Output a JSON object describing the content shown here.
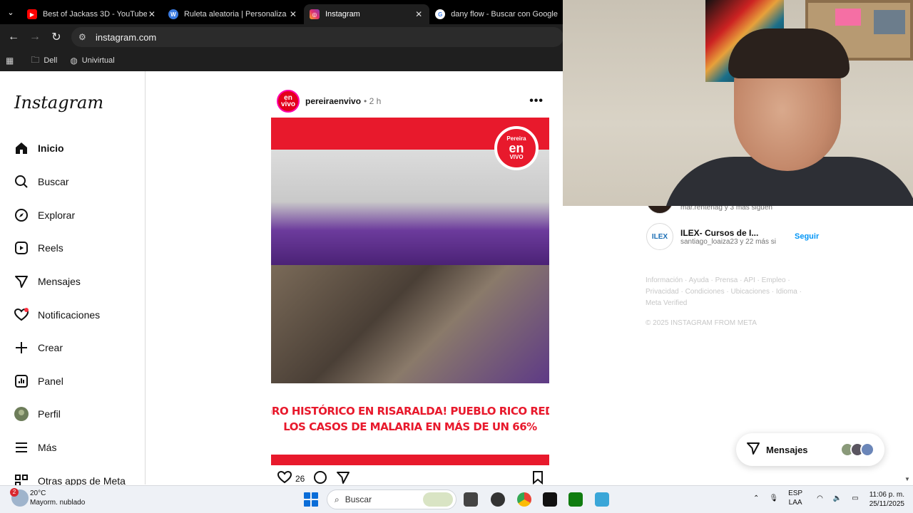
{
  "browser": {
    "tabs": [
      {
        "title": "Best of Jackass 3D - YouTube",
        "favicon": "youtube-icon",
        "active": false
      },
      {
        "title": "Ruleta aleatoria | Personaliza y c",
        "favicon": "wheel-icon",
        "active": false
      },
      {
        "title": "Instagram",
        "favicon": "instagram-icon",
        "active": true
      },
      {
        "title": "dany flow - Buscar con Google",
        "favicon": "google-icon",
        "active": false
      }
    ],
    "url": "instagram.com",
    "bookmarks": [
      {
        "label": "Dell",
        "icon": "folder-icon"
      },
      {
        "label": "Univirtual",
        "icon": "globe-icon"
      }
    ]
  },
  "instagram": {
    "logo": "Instagram",
    "nav": [
      {
        "label": "Inicio",
        "icon": "home-icon"
      },
      {
        "label": "Buscar",
        "icon": "search-icon"
      },
      {
        "label": "Explorar",
        "icon": "compass-icon"
      },
      {
        "label": "Reels",
        "icon": "reels-icon"
      },
      {
        "label": "Mensajes",
        "icon": "send-icon"
      },
      {
        "label": "Notificaciones",
        "icon": "heart-icon"
      },
      {
        "label": "Crear",
        "icon": "plus-icon"
      },
      {
        "label": "Panel",
        "icon": "chart-icon"
      },
      {
        "label": "Perfil",
        "icon": "profile-avatar"
      },
      {
        "label": "Más",
        "icon": "menu-icon"
      },
      {
        "label": "Otras apps de Meta",
        "icon": "apps-icon"
      }
    ],
    "post": {
      "username": "pereiraenvivo",
      "time": "• 2 h",
      "avatar_text": "en vivo",
      "image_logo": {
        "line1": "Pereira",
        "line2": "en",
        "line3": "VIVO"
      },
      "caption_lines": [
        "¡LOGRO HISTÓRICO EN RISARALDA! PUEBLO RICO REDUCE",
        "LOS CASOS DE MALARIA EN MÁS DE UN 66%"
      ],
      "likes": "26"
    },
    "suggestions": [
      {
        "name": "",
        "sub": "mar.renteriag y 3 más siguen",
        "follow": ""
      },
      {
        "name": "ILEX- Cursos de I...",
        "sub": "santiago_loaiza23 y 22 más si",
        "follow": "Seguir",
        "avatar_text": "ILEX"
      }
    ],
    "footer": {
      "links": "Información · Ayuda · Prensa · API · Empleo · Privacidad · Condiciones · Ubicaciones · Idioma · Meta Verified",
      "copyright": "© 2025 INSTAGRAM FROM META"
    },
    "messages_pill": "Mensajes"
  },
  "taskbar": {
    "weather_temp": "20°C",
    "weather_desc": "Mayorm. nublado",
    "weather_badge": "2",
    "search_placeholder": "Buscar",
    "lang_line1": "ESP",
    "lang_line2": "LAA",
    "time": "11:06 p. m.",
    "date": "25/11/2025"
  },
  "colors": {
    "brand_red": "#e8192c",
    "follow_blue": "#0095f6",
    "windows_blue": "#0a6dd8"
  }
}
